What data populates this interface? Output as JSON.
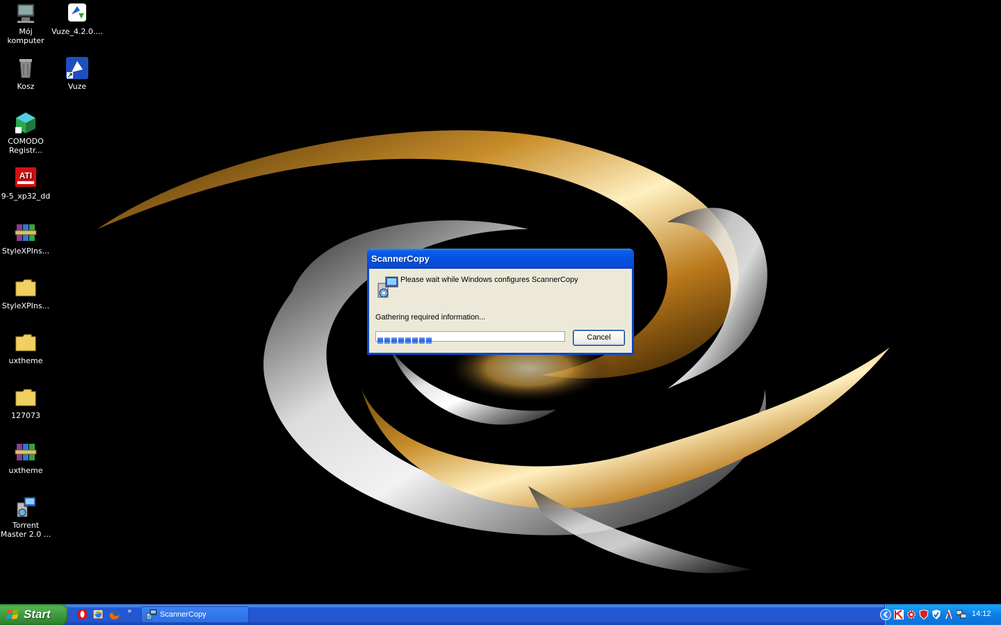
{
  "desktop": {
    "icons": [
      {
        "label": "Mój komputer",
        "icon": "computer-icon"
      },
      {
        "label": "Vuze_4.2.0....",
        "icon": "vuze-installer-icon"
      },
      {
        "label": "Kosz",
        "icon": "recycle-bin-icon"
      },
      {
        "label": "Vuze",
        "icon": "vuze-icon"
      },
      {
        "label": "COMODO Registr...",
        "icon": "comodo-icon"
      },
      {
        "label": "9-5_xp32_dd",
        "icon": "ati-icon"
      },
      {
        "label": "StyleXPIns...",
        "icon": "winrar-archive-icon"
      },
      {
        "label": "StyleXPIns...",
        "icon": "folder-icon"
      },
      {
        "label": "uxtheme",
        "icon": "folder-icon"
      },
      {
        "label": "127073",
        "icon": "folder-icon"
      },
      {
        "label": "uxtheme",
        "icon": "winrar-archive-icon"
      },
      {
        "label": "Torrent Master 2.0 ...",
        "icon": "installer-icon"
      }
    ]
  },
  "dialog": {
    "title": "ScannerCopy",
    "message": "Please wait while Windows configures ScannerCopy",
    "status": "Gathering required information...",
    "progress": 0.3,
    "cancel_label": "Cancel"
  },
  "taskbar": {
    "start_label": "Start",
    "quick_launch": [
      "opera-icon",
      "internet-explorer-icon",
      "firefox-icon"
    ],
    "quick_launch_more": "»",
    "tasks": [
      {
        "label": "ScannerCopy",
        "icon": "installer-icon"
      }
    ],
    "tray_icons": [
      "chevron-left-icon",
      "k-icon",
      "red-gear-icon",
      "shield-red-icon",
      "antivirus-icon",
      "shield-icon",
      "network-icon",
      "computer-network-icon"
    ],
    "clock": "14:12"
  },
  "colors": {
    "taskbar": "#2456cf",
    "start": "#3c963c",
    "dialog_title": "#0551e0",
    "dialog_body": "#ece9d8",
    "progress": "#2561d8"
  }
}
